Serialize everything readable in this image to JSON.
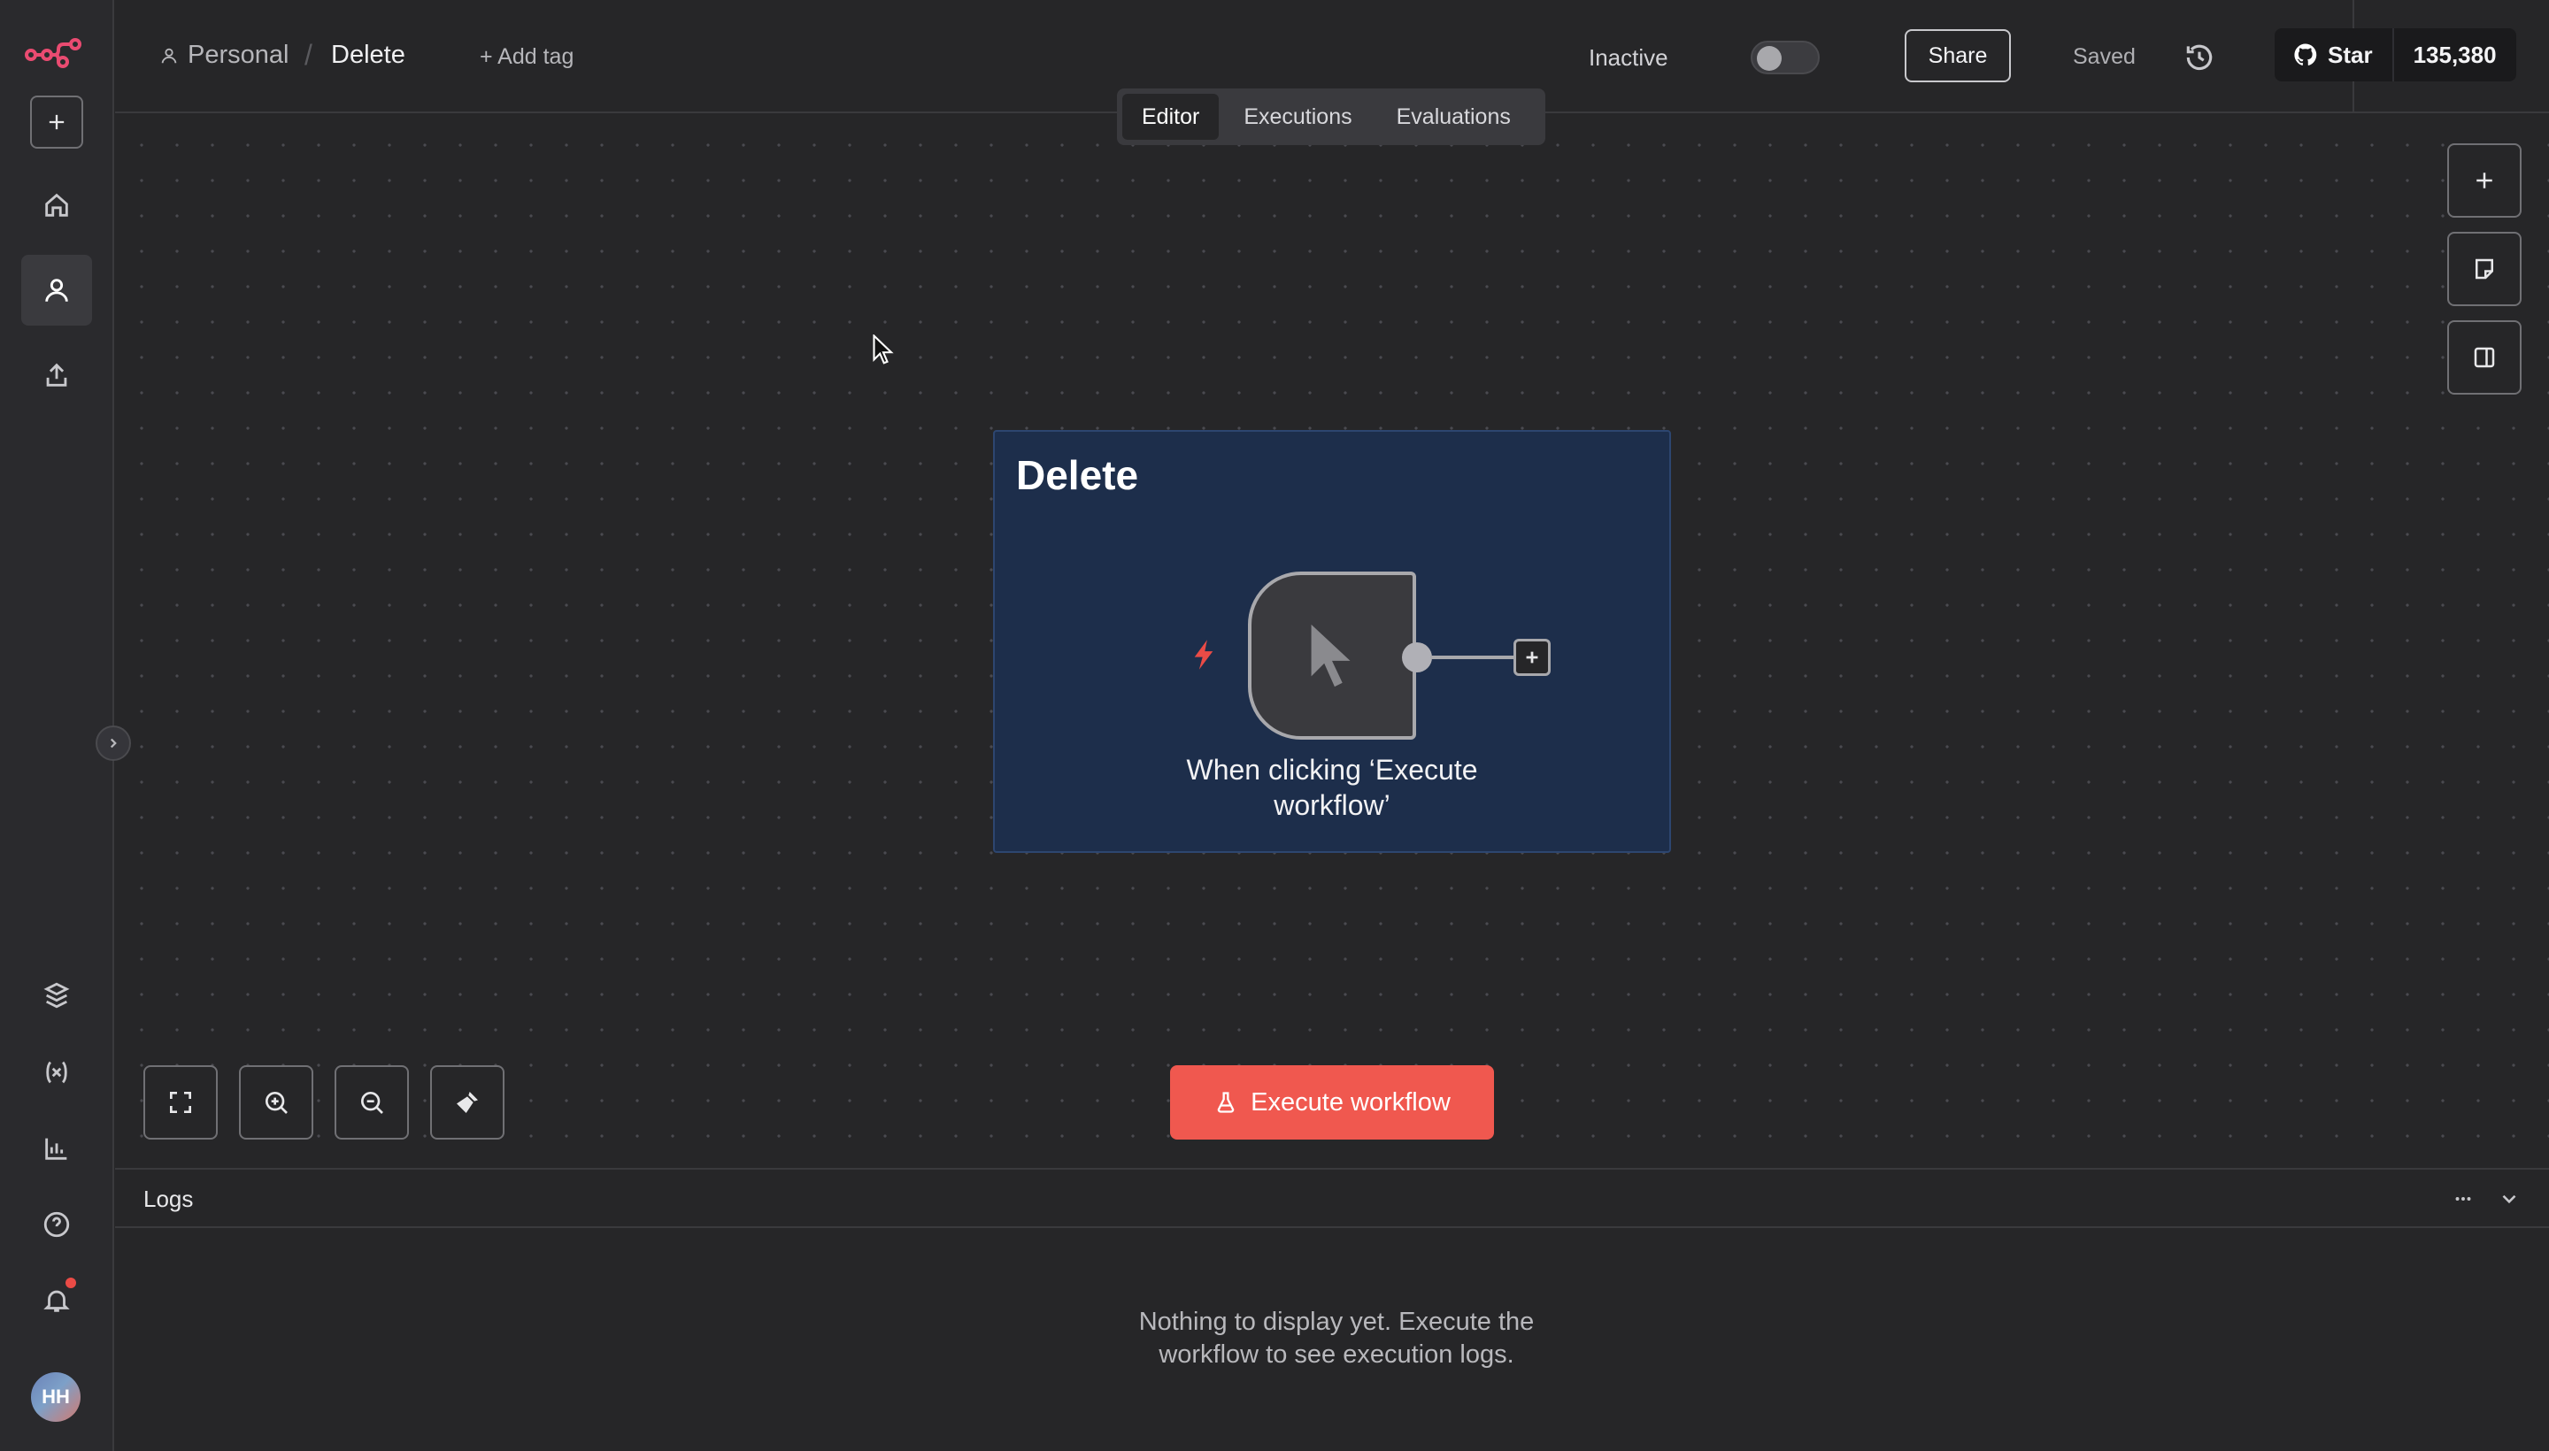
{
  "breadcrumb": {
    "project": "Personal",
    "separator": "/",
    "workflow": "Delete"
  },
  "header": {
    "add_tag": "+ Add tag",
    "status_label": "Inactive",
    "status_active": false,
    "share": "Share",
    "save_state": "Saved",
    "github": {
      "star": "Star",
      "count": "135,380"
    }
  },
  "tabs": [
    {
      "label": "Editor",
      "active": true
    },
    {
      "label": "Executions",
      "active": false
    },
    {
      "label": "Evaluations",
      "active": false
    }
  ],
  "sidebar": {
    "items": [
      "new-workflow",
      "home",
      "personal",
      "upload",
      "templates",
      "variables",
      "insights",
      "help",
      "notifications"
    ],
    "avatar_initials": "HH"
  },
  "canvas": {
    "sticky_note": {
      "title": "Delete",
      "color": "#1d2e4b"
    },
    "node": {
      "label": "When clicking ‘Execute workflow’",
      "icon": "cursor-pointer-icon",
      "trigger_color": "#ea4b46"
    },
    "execute_button": "Execute workflow",
    "accent": "#f0584f"
  },
  "logs": {
    "title": "Logs",
    "empty_message": "Nothing to display yet. Execute the workflow to see execution logs."
  }
}
